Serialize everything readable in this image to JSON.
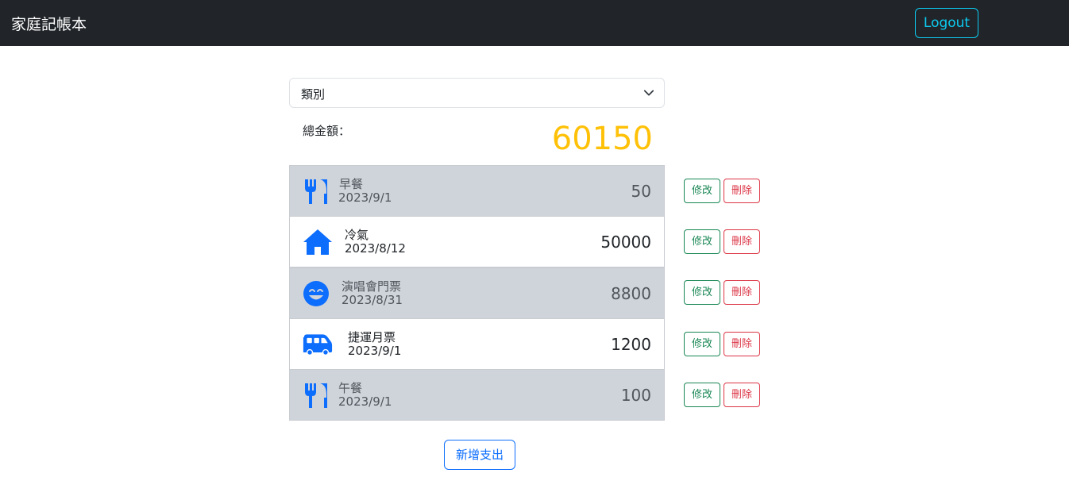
{
  "app": {
    "title": "家庭記帳本",
    "logout_label": "Logout"
  },
  "filter": {
    "selected": "類別"
  },
  "total": {
    "label": "總金額：",
    "value": "60150"
  },
  "expenses": [
    {
      "icon": "utensils-icon",
      "name": "早餐",
      "date": "2023/9/1",
      "amount": "50"
    },
    {
      "icon": "house-icon",
      "name": "冷氣",
      "date": "2023/8/12",
      "amount": "50000"
    },
    {
      "icon": "smile-icon",
      "name": "演唱會門票",
      "date": "2023/8/31",
      "amount": "8800"
    },
    {
      "icon": "van-icon",
      "name": "捷運月票",
      "date": "2023/9/1",
      "amount": "1200"
    },
    {
      "icon": "utensils-icon",
      "name": "午餐",
      "date": "2023/9/1",
      "amount": "100"
    }
  ],
  "actions": {
    "edit_label": "修改",
    "delete_label": "刪除",
    "add_label": "新增支出"
  },
  "colors": {
    "navbar": "#212529",
    "accent": "#0d6efd",
    "total": "#ffc107",
    "edit": "#198754",
    "delete": "#dc3545",
    "logout": "#0dcaf0"
  }
}
